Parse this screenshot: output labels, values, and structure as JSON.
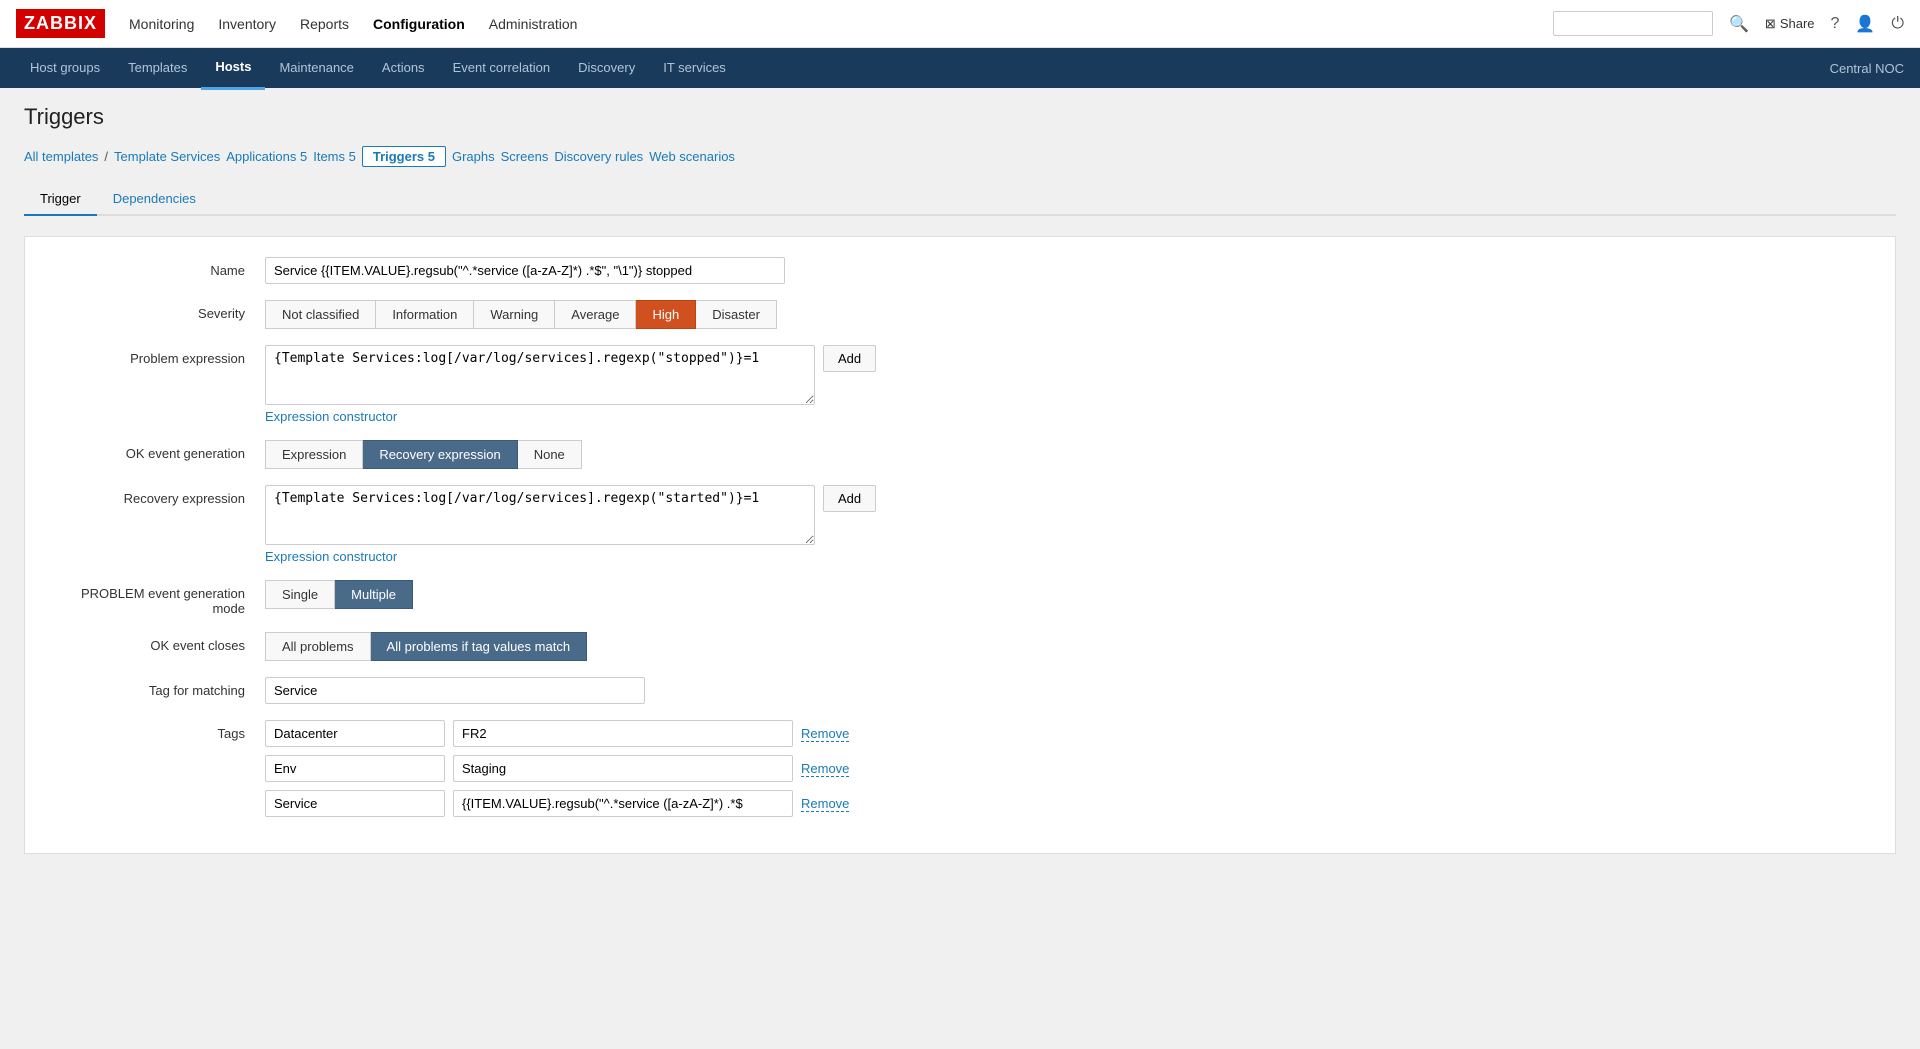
{
  "logo": "ZABBIX",
  "topnav": {
    "links": [
      {
        "label": "Monitoring",
        "active": false
      },
      {
        "label": "Inventory",
        "active": false
      },
      {
        "label": "Reports",
        "active": false
      },
      {
        "label": "Configuration",
        "active": true
      },
      {
        "label": "Administration",
        "active": false
      }
    ],
    "share": "Share",
    "search_placeholder": ""
  },
  "subnav": {
    "links": [
      {
        "label": "Host groups",
        "active": false
      },
      {
        "label": "Templates",
        "active": false
      },
      {
        "label": "Hosts",
        "active": true
      },
      {
        "label": "Maintenance",
        "active": false
      },
      {
        "label": "Actions",
        "active": false
      },
      {
        "label": "Event correlation",
        "active": false
      },
      {
        "label": "Discovery",
        "active": false
      },
      {
        "label": "IT services",
        "active": false
      }
    ],
    "right_label": "Central NOC"
  },
  "page_title": "Triggers",
  "breadcrumb": {
    "all_templates": "All templates",
    "separator": "/",
    "template_services": "Template Services",
    "links": [
      {
        "label": "Applications",
        "count": "5"
      },
      {
        "label": "Items",
        "count": "5"
      },
      {
        "label": "Triggers",
        "count": "5",
        "active": true
      },
      {
        "label": "Graphs"
      },
      {
        "label": "Screens"
      },
      {
        "label": "Discovery rules"
      },
      {
        "label": "Web scenarios"
      }
    ]
  },
  "form_tabs": [
    {
      "label": "Trigger",
      "active": true
    },
    {
      "label": "Dependencies",
      "active": false
    }
  ],
  "form": {
    "name_label": "Name",
    "name_value": "Service {{ITEM.VALUE}.regsub(\"^.*service ([a-zA-Z]*) .*$\", \"\\1\")} stopped",
    "severity_label": "Severity",
    "severity_buttons": [
      {
        "label": "Not classified",
        "active": false
      },
      {
        "label": "Information",
        "active": false
      },
      {
        "label": "Warning",
        "active": false
      },
      {
        "label": "Average",
        "active": false
      },
      {
        "label": "High",
        "active": true
      },
      {
        "label": "Disaster",
        "active": false
      }
    ],
    "problem_expression_label": "Problem expression",
    "problem_expression_value": "{Template Services:log[/var/log/services].regexp(\"stopped\")}=1",
    "add_label": "Add",
    "expression_constructor_link": "Expression constructor",
    "ok_event_generation_label": "OK event generation",
    "ok_event_buttons": [
      {
        "label": "Expression",
        "active": false
      },
      {
        "label": "Recovery expression",
        "active": true
      },
      {
        "label": "None",
        "active": false
      }
    ],
    "recovery_expression_label": "Recovery expression",
    "recovery_expression_value": "{Template Services:log[/var/log/services].regexp(\"started\")}=1",
    "problem_event_mode_label": "PROBLEM event generation mode",
    "problem_event_buttons": [
      {
        "label": "Single",
        "active": false
      },
      {
        "label": "Multiple",
        "active": true
      }
    ],
    "ok_event_closes_label": "OK event closes",
    "ok_event_closes_buttons": [
      {
        "label": "All problems",
        "active": false
      },
      {
        "label": "All problems if tag values match",
        "active": true
      }
    ],
    "tag_matching_label": "Tag for matching",
    "tag_matching_value": "Service",
    "tags_label": "Tags",
    "tags": [
      {
        "name": "Datacenter",
        "value": "FR2"
      },
      {
        "name": "Env",
        "value": "Staging"
      },
      {
        "name": "Service",
        "value": "{{ITEM.VALUE}.regsub(\"^.*service ([a-zA-Z]*) .*$"
      }
    ],
    "remove_label": "Remove"
  }
}
